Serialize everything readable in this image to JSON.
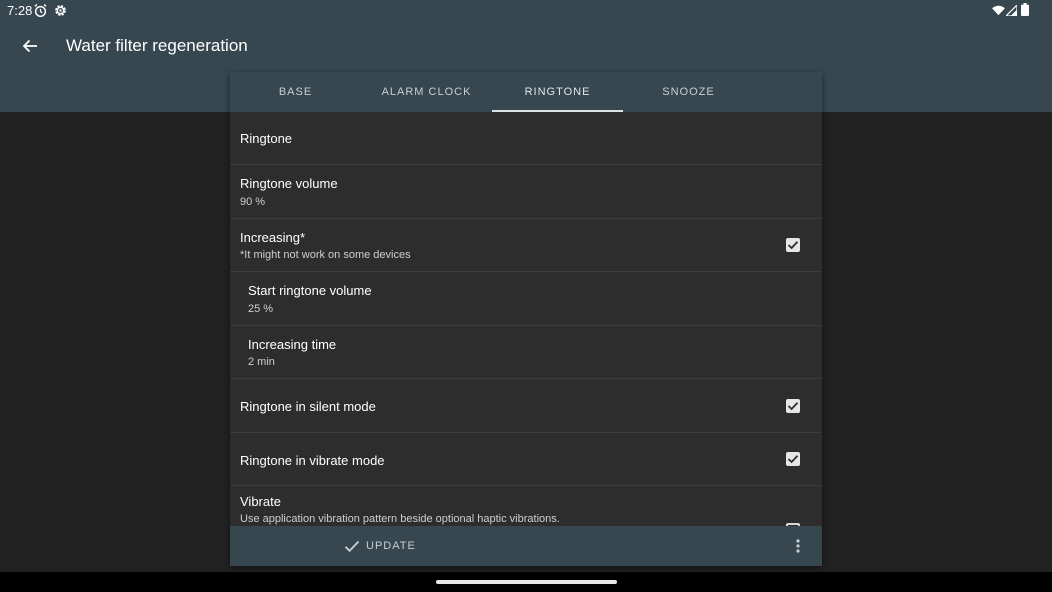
{
  "status_bar": {
    "time": "7:28",
    "left_icons": [
      "alarm-icon",
      "settings-gear-icon"
    ],
    "right_icons": [
      "wifi-icon",
      "signal-icon",
      "battery-icon"
    ]
  },
  "app_bar": {
    "title": "Water filter regeneration",
    "back_icon": "arrow-back-icon"
  },
  "tabs": [
    {
      "label": "BASE",
      "active": false
    },
    {
      "label": "ALARM CLOCK",
      "active": false
    },
    {
      "label": "RINGTONE",
      "active": true
    },
    {
      "label": "SNOOZE",
      "active": false
    }
  ],
  "settings": [
    {
      "title": "Ringtone",
      "subtitle": ""
    },
    {
      "title": "Ringtone volume",
      "subtitle": "90 %"
    },
    {
      "title": "Increasing*",
      "subtitle": "*It might not work on some devices",
      "checked": true
    },
    {
      "title": "Start ringtone volume",
      "subtitle": "25 %"
    },
    {
      "title": "Increasing time",
      "subtitle": "2 min"
    },
    {
      "title": "Ringtone in silent mode",
      "subtitle": "",
      "checked": true
    },
    {
      "title": "Ringtone in vibrate mode",
      "subtitle": "",
      "checked": true
    },
    {
      "title": "Vibrate",
      "subtitle": "Use application vibration pattern beside optional haptic vibrations.",
      "checked": false
    }
  ],
  "bottom_bar": {
    "update_label": "UPDATE",
    "update_icon": "check-icon",
    "more_icon": "more-vert-icon"
  },
  "colors": {
    "app_bar": "#37474f",
    "background": "#222222",
    "dialog": "#2d2d2d"
  }
}
